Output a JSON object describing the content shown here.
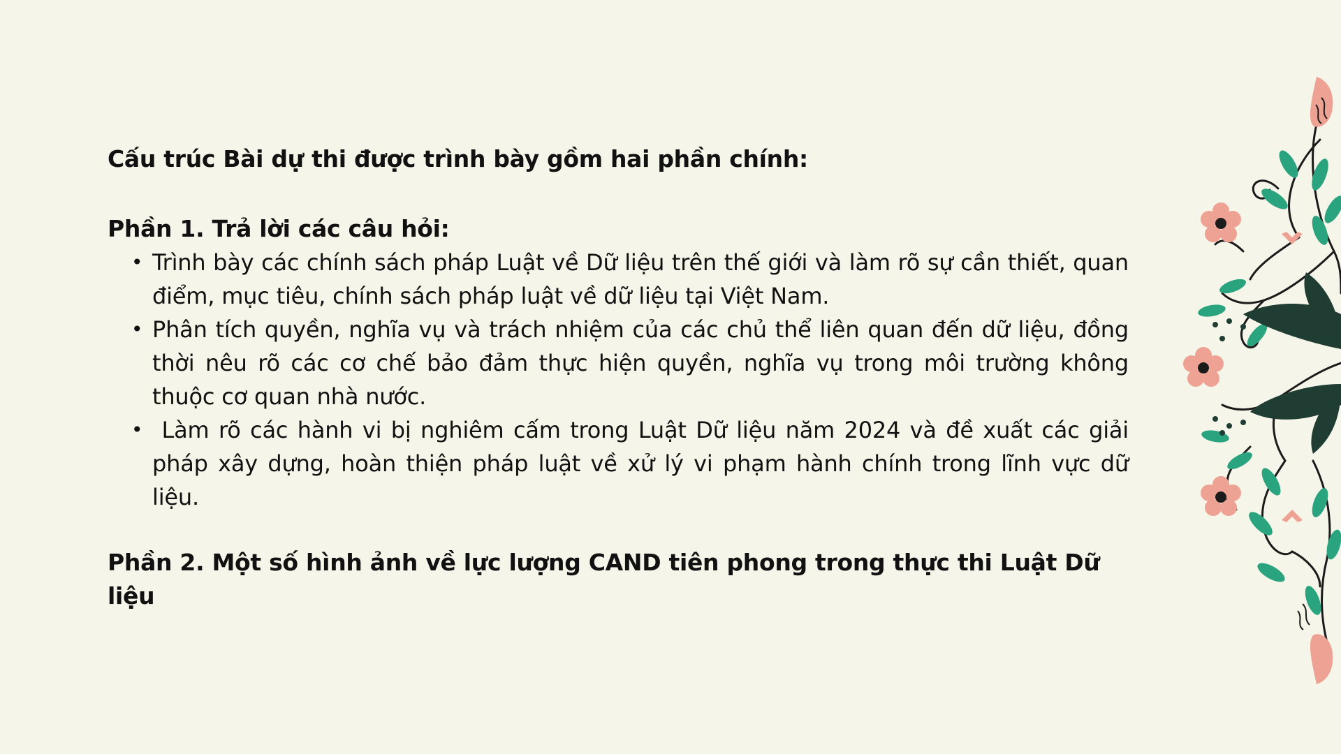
{
  "slide": {
    "heading": "Cấu trúc Bài dự thi được trình bày gồm hai phần chính:",
    "part1": {
      "title": "Phần 1. Trả lời  các câu hỏi:",
      "items": [
        "Trình bày các chính sách pháp Luật về Dữ liệu trên thế giới và làm rõ sự cần thiết, quan điểm, mục tiêu, chính sách pháp luật về dữ liệu tại Việt Nam.",
        "Phân tích quyền, nghĩa vụ và trách nhiệm của các chủ thể liên quan đến dữ liệu, đồng thời nêu rõ các cơ chế bảo đảm thực hiện quyền, nghĩa vụ trong môi trường không thuộc cơ quan nhà nước.",
        " Làm rõ các hành vi bị nghiêm cấm trong Luật Dữ liệu năm 2024 và đề xuất các giải pháp xây dựng, hoàn thiện pháp luật về xử lý vi phạm hành chính trong lĩnh vực dữ liệu."
      ],
      "bullet_glyph": "•"
    },
    "part2": {
      "title": "Phần 2. Một số hình ảnh về lực lượng CAND tiên phong trong thực thi Luật Dữ liệu"
    }
  },
  "colors": {
    "background": "#f6f5e9",
    "text": "#111111",
    "leaf_dark": "#1f3d33",
    "leaf_teal": "#2aa37f",
    "flower_pink": "#eea293",
    "stem": "#1b1b1b"
  },
  "icons": {
    "decoration": "floral-border-illustration"
  }
}
